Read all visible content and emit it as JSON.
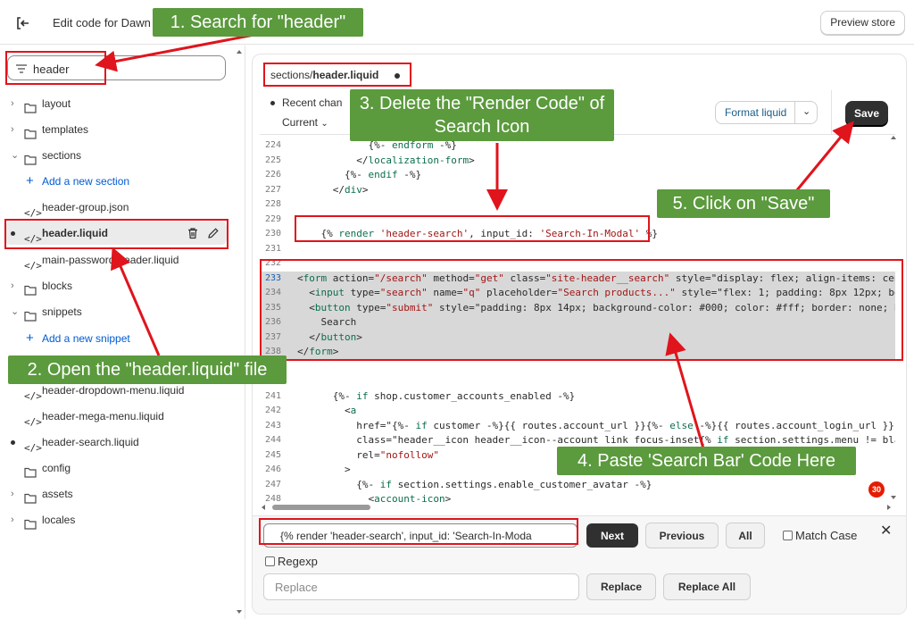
{
  "topbar": {
    "title": "Edit code for Dawn",
    "preview_label": "Preview store"
  },
  "sidebar": {
    "search_value": "header",
    "items": [
      {
        "label": "layout"
      },
      {
        "label": "templates"
      },
      {
        "label": "sections"
      },
      {
        "label": "Add a new section"
      },
      {
        "label": "header-group.json"
      },
      {
        "label": "header.liquid"
      },
      {
        "label": "main-password-header.liquid"
      },
      {
        "label": "blocks"
      },
      {
        "label": "snippets"
      },
      {
        "label": "Add a new snippet"
      },
      {
        "label": "header-dropdown-menu.liquid"
      },
      {
        "label": "header-mega-menu.liquid"
      },
      {
        "label": "header-search.liquid"
      },
      {
        "label": "config"
      },
      {
        "label": "assets"
      },
      {
        "label": "locales"
      }
    ]
  },
  "editor": {
    "tab_folder": "sections/",
    "tab_file": "header.liquid",
    "recent_label": "Recent chan",
    "current_label": "Current",
    "format_label": "Format liquid",
    "save_label": "Save",
    "badge": "30",
    "lines": [
      {
        "n": "224",
        "code": "            {%- endform -%}"
      },
      {
        "n": "225",
        "code": "          </localization-form>"
      },
      {
        "n": "226",
        "code": "        {%- endif -%}"
      },
      {
        "n": "227",
        "code": "      </div>"
      },
      {
        "n": "228",
        "code": ""
      },
      {
        "n": "229",
        "code": ""
      },
      {
        "n": "230",
        "code": "    {% render 'header-search', input_id: 'Search-In-Modal' %}"
      },
      {
        "n": "231",
        "code": ""
      },
      {
        "n": "232",
        "code": ""
      },
      {
        "n": "233",
        "code": "<form action=\"/search\" method=\"get\" class=\"site-header__search\" style=\"display: flex; align-items: cen"
      },
      {
        "n": "234",
        "code": "  <input type=\"search\" name=\"q\" placeholder=\"Search products...\" style=\"flex: 1; padding: 8px 12px; bo"
      },
      {
        "n": "235",
        "code": "  <button type=\"submit\" style=\"padding: 8px 14px; background-color: #000; color: #fff; border: none; b"
      },
      {
        "n": "236",
        "code": "    Search"
      },
      {
        "n": "237",
        "code": "  </button>"
      },
      {
        "n": "238",
        "code": "</form>"
      },
      {
        "n": "239",
        "code": ""
      },
      {
        "n": "240",
        "code": ""
      },
      {
        "n": "241",
        "code": "      {%- if shop.customer_accounts_enabled -%}"
      },
      {
        "n": "242",
        "code": "        <a"
      },
      {
        "n": "243",
        "code": "          href=\"{%- if customer -%}{{ routes.account_url }}{%- else -%}{{ routes.account_login_url }}{"
      },
      {
        "n": "244",
        "code": "          class=\"header__icon header__icon--account link focus-inset{% if section.settings.menu != bla"
      },
      {
        "n": "245",
        "code": "          rel=\"nofollow\""
      },
      {
        "n": "246",
        "code": "        >"
      },
      {
        "n": "247",
        "code": "          {%- if section.settings.enable_customer_avatar -%}"
      },
      {
        "n": "248",
        "code": "            <account-icon>"
      }
    ]
  },
  "find": {
    "find_value": "{% render 'header-search', input_id: 'Search-In-Moda",
    "next_label": "Next",
    "previous_label": "Previous",
    "all_label": "All",
    "match_case_label": "Match Case",
    "regexp_label": "Regexp",
    "replace_placeholder": "Replace",
    "replace_label": "Replace",
    "replace_all_label": "Replace All"
  },
  "annotations": {
    "step1": "1. Search for \"header\"",
    "step2": "2. Open the \"header.liquid\" file",
    "step3": "3. Delete the \"Render Code\" of Search Icon",
    "step4": "4. Paste 'Search Bar' Code Here",
    "step5": "5. Click on \"Save\""
  },
  "colors": {
    "annotation_red": "#e0141c",
    "annotation_green": "#5b9a3d",
    "save_button": "#303030",
    "link_blue": "#005bd3"
  }
}
